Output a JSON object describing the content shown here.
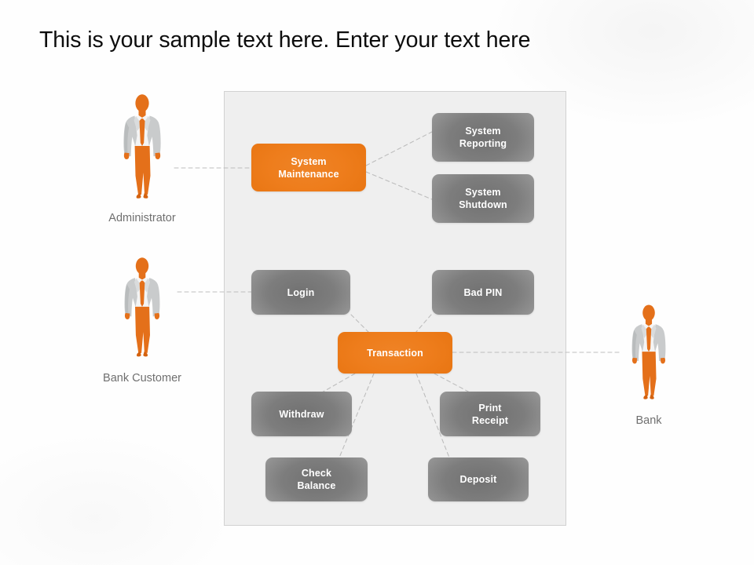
{
  "slide": {
    "title": "This is your sample text here. Enter your text here",
    "background_color": "#fefefe"
  },
  "system_boundary": {
    "name": "system-boundary",
    "fill_color": "#efefef",
    "border_color": "#d2d2d2"
  },
  "theme": {
    "accent_orange": "#e87512",
    "usecase_gray": "#8a8a8a",
    "label_gray": "#6f6f6f",
    "title_color": "#0d0d0d",
    "connector_color": "#bdbdbd",
    "actor_suit": "#c9cbcc",
    "actor_accent": "#e4701a",
    "actor_shirt": "#f2f2f2"
  },
  "actors": [
    {
      "id": "administrator",
      "label": "Administrator",
      "position": "left-top",
      "connects_to": "System Maintenance"
    },
    {
      "id": "bank-customer",
      "label": "Bank Customer",
      "position": "left-middle",
      "connects_to": "Login"
    },
    {
      "id": "bank",
      "label": "Bank",
      "position": "right",
      "connects_to": "Transaction"
    }
  ],
  "use_cases": [
    {
      "id": "system-maintenance",
      "label_line1": "System",
      "label_line2": "Maintenance",
      "style": "orange"
    },
    {
      "id": "system-reporting",
      "label_line1": "System",
      "label_line2": "Reporting",
      "style": "gray"
    },
    {
      "id": "system-shutdown",
      "label_line1": "System",
      "label_line2": "Shutdown",
      "style": "gray"
    },
    {
      "id": "login",
      "label_line1": "Login",
      "label_line2": "",
      "style": "gray"
    },
    {
      "id": "bad-pin",
      "label_line1": "Bad PIN",
      "label_line2": "",
      "style": "gray"
    },
    {
      "id": "transaction",
      "label_line1": "Transaction",
      "label_line2": "",
      "style": "orange"
    },
    {
      "id": "withdraw",
      "label_line1": "Withdraw",
      "label_line2": "",
      "style": "gray"
    },
    {
      "id": "print-receipt",
      "label_line1": "Print",
      "label_line2": "Receipt",
      "style": "gray"
    },
    {
      "id": "check-balance",
      "label_line1": "Check",
      "label_line2": "Balance",
      "style": "gray"
    },
    {
      "id": "deposit",
      "label_line1": "Deposit",
      "label_line2": "",
      "style": "gray"
    }
  ],
  "relationships": [
    {
      "from": "Administrator",
      "to": "System Maintenance"
    },
    {
      "from": "System Maintenance",
      "to": "System Reporting"
    },
    {
      "from": "System Maintenance",
      "to": "System Shutdown"
    },
    {
      "from": "Bank Customer",
      "to": "Login"
    },
    {
      "from": "Login",
      "to": "Transaction"
    },
    {
      "from": "Bad PIN",
      "to": "Transaction"
    },
    {
      "from": "Transaction",
      "to": "Withdraw"
    },
    {
      "from": "Transaction",
      "to": "Check Balance"
    },
    {
      "from": "Transaction",
      "to": "Deposit"
    },
    {
      "from": "Transaction",
      "to": "Print Receipt"
    },
    {
      "from": "Transaction",
      "to": "Bank"
    }
  ]
}
